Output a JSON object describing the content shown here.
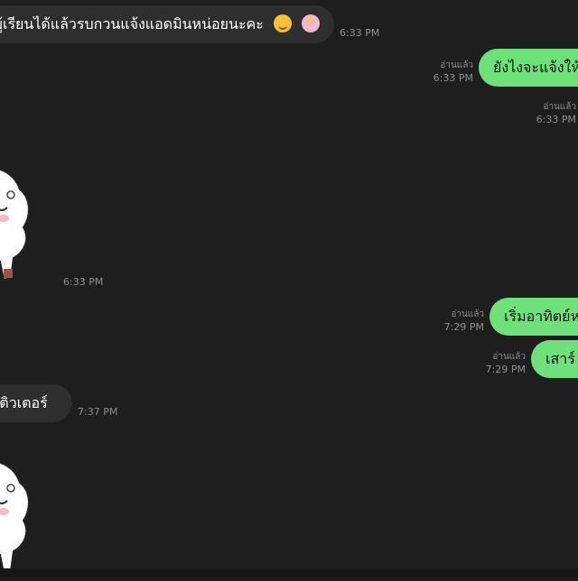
{
  "messages": [
    {
      "side": "received",
      "text": "อผู้เรียนได้แล้วรบกวนแจ้งแอดมินหน่อยนะคะ",
      "emoji": [
        "smiling-face-emoji",
        "person-raising-hand-emoji"
      ],
      "time": "6:33 PM"
    },
    {
      "side": "sent",
      "text": "ยังไงจะแจ้งให้",
      "read": "อ่านแล้ว",
      "time": "6:33 PM"
    },
    {
      "side": "sent-meta-only",
      "read": "อ่านแล้ว",
      "time": "6:33 PM"
    },
    {
      "side": "received-sticker",
      "sticker": "sheep-sticker",
      "time": "6:33 PM"
    },
    {
      "side": "sent",
      "text": "เริ่มอาทิตย์ห",
      "read": "อ่านแล้ว",
      "time": "7:29 PM"
    },
    {
      "side": "sent",
      "text": "เสาร์",
      "read": "อ่านแล้ว",
      "time": "7:29 PM"
    },
    {
      "side": "received",
      "text": "ค่ะติวเตอร์",
      "time": "7:37 PM"
    },
    {
      "side": "received-sticker",
      "sticker": "sheep-sticker"
    }
  ],
  "colors": {
    "background": "#1e1e1e",
    "sent_bubble": "#6ee17a",
    "received_bubble": "#2e2e2e",
    "meta": "#8e8e8e"
  }
}
